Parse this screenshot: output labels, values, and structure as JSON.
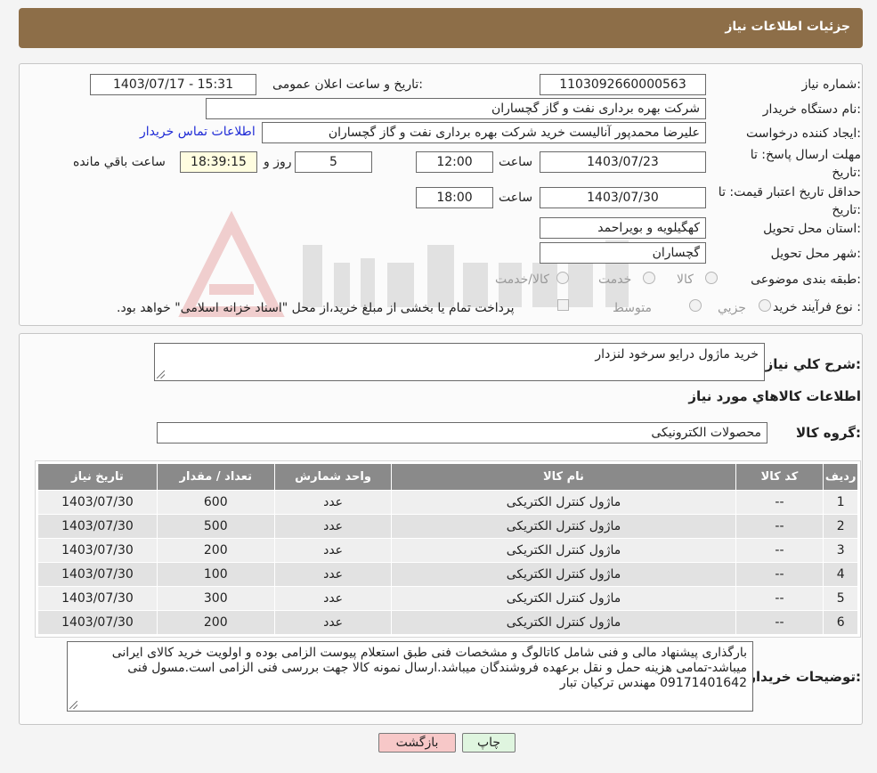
{
  "header": {
    "title": "جزئیات اطلاعات نیاز"
  },
  "labels": {
    "need_number": "شماره نیاز:",
    "announce_datetime": "تاریخ و ساعت اعلان عمومی:",
    "buyer_org": "نام دستگاه خریدار:",
    "requester": "ایجاد کننده درخواست:",
    "contact_link": "اطلاعات تماس خریدار",
    "reply_deadline_line1": "مهلت ارسال پاسخ: تا",
    "reply_deadline_line2": "تاریخ:",
    "time_word": "ساعت",
    "day_and": "روز و",
    "remaining": "ساعت باقي مانده",
    "price_validity_line1": "حداقل تاریخ اعتبار قیمت: تا",
    "price_validity_line2": "تاریخ:",
    "province": "استان محل تحویل:",
    "city": "شهر محل تحویل:",
    "category": "طبقه بندی موضوعی:",
    "process_type": "نوع فرآیند خرید :"
  },
  "values": {
    "need_number": "1103092660000563",
    "announce_datetime": "1403/07/17 - 15:31",
    "buyer_org": "شرکت بهره برداری نفت و گاز گچساران",
    "requester": "علیرضا محمدپور آنالیست خرید شرکت بهره برداری نفت و گاز گچساران",
    "reply_date": "1403/07/23",
    "reply_time": "12:00",
    "reply_days": "5",
    "reply_remaining": "18:39:15",
    "validity_date": "1403/07/30",
    "validity_time": "18:00",
    "province": "کهگیلویه و بویراحمد",
    "city": "گچساران"
  },
  "category_options": [
    "کالا",
    "خدمت",
    "کالا/خدمت"
  ],
  "process_options": [
    "جزیي",
    "متوسط"
  ],
  "process_note": "پرداخت تمام یا بخشی از مبلغ خرید،از محل \"اسناد خزانه اسلامی\" خواهد بود.",
  "description": {
    "label": "شرح کلي نیاز:",
    "value": "خرید ماژول درایو سرخود لنزدار"
  },
  "goods": {
    "section_title": "اطلاعات کالاهاي مورد نیاز",
    "group_label": "گروه کالا:",
    "group_value": "محصولات الکترونیکی"
  },
  "table": {
    "headers": [
      "ردیف",
      "کد کالا",
      "نام کالا",
      "واحد شمارش",
      "تعداد / مقدار",
      "تاریخ نیاز"
    ],
    "rows": [
      [
        "1",
        "--",
        "ماژول کنترل الکتریکی",
        "عدد",
        "600",
        "1403/07/30"
      ],
      [
        "2",
        "--",
        "ماژول کنترل الکتریکی",
        "عدد",
        "500",
        "1403/07/30"
      ],
      [
        "3",
        "--",
        "ماژول کنترل الکتریکی",
        "عدد",
        "200",
        "1403/07/30"
      ],
      [
        "4",
        "--",
        "ماژول کنترل الکتریکی",
        "عدد",
        "100",
        "1403/07/30"
      ],
      [
        "5",
        "--",
        "ماژول کنترل الکتریکی",
        "عدد",
        "300",
        "1403/07/30"
      ],
      [
        "6",
        "--",
        "ماژول کنترل الکتریکی",
        "عدد",
        "200",
        "1403/07/30"
      ]
    ]
  },
  "buyer_notes": {
    "label": "توضیحات خریدار:",
    "value": "بارگذاری پیشنهاد مالی و فنی شامل کاتالوگ و مشخصات فنی طبق استعلام پیوست الزامی بوده و اولویت خرید کالای ایرانی میباشد-تمامی هزینه حمل و نقل برعهده فروشندگان میباشد.ارسال نمونه کالا جهت بررسی فنی الزامی است.مسول فنی 09171401642 مهندس ترکیان تبار"
  },
  "buttons": {
    "print": "چاپ",
    "back": "بازگشت"
  },
  "colors": {
    "header_bg": "#8d6e48",
    "table_header": "#8a8a8a",
    "back_button": "#f7c8c8",
    "print_button": "#dff5df",
    "link": "#1f2bd6"
  }
}
